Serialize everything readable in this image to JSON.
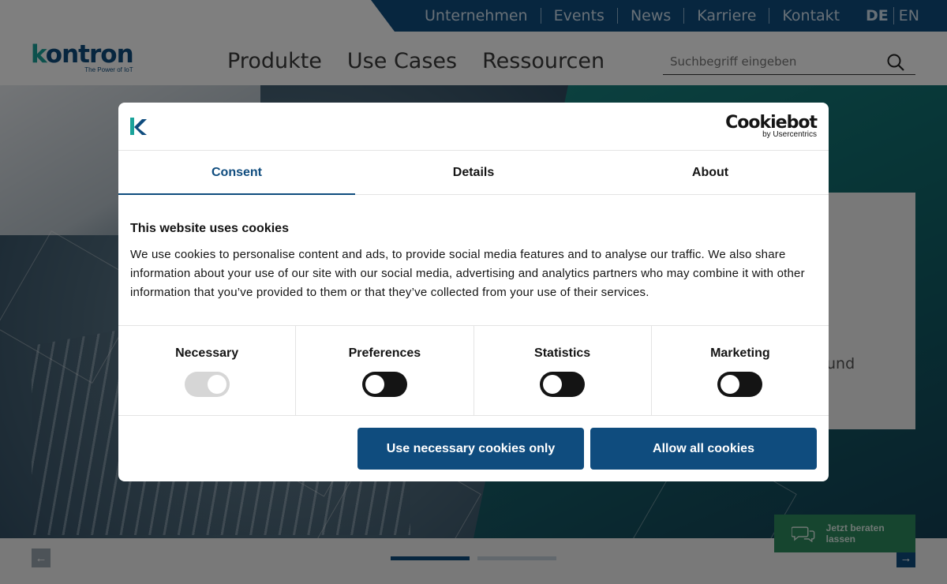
{
  "utility_nav": [
    "Unternehmen",
    "Events",
    "News",
    "Karriere",
    "Kontakt"
  ],
  "languages": {
    "de": "DE",
    "en": "EN"
  },
  "brand": {
    "name_k": "k",
    "name_rest": "ontron",
    "tagline": "The Power of IoT"
  },
  "main_nav": [
    "Produkte",
    "Use Cases",
    "Ressourcen"
  ],
  "search": {
    "placeholder": "Suchbegriff eingeben"
  },
  "hero": {
    "card_fragment": "und"
  },
  "chat": {
    "label": "Jetzt beraten lassen"
  },
  "cookie_dialog": {
    "provider": {
      "name": "Cookiebot",
      "byline": "by Usercentrics"
    },
    "tabs": [
      {
        "label": "Consent",
        "active": true
      },
      {
        "label": "Details",
        "active": false
      },
      {
        "label": "About",
        "active": false
      }
    ],
    "heading": "This website uses cookies",
    "text": "We use cookies to personalise content and ads, to provide social media features and to analyse our traffic. We also share information about your use of our site with our social media, advertising and analytics partners who may combine it with other information that you’ve provided to them or that they’ve collected from your use of their services.",
    "categories": [
      {
        "label": "Necessary",
        "state": "on-disabled"
      },
      {
        "label": "Preferences",
        "state": "off"
      },
      {
        "label": "Statistics",
        "state": "off"
      },
      {
        "label": "Marketing",
        "state": "off"
      }
    ],
    "buttons": {
      "necessary": "Use necessary cookies only",
      "allow_all": "Allow all cookies"
    }
  },
  "colors": {
    "brand_blue": "#0f4c7e",
    "brand_teal": "#1aa39a",
    "chat_green": "#2d8a5f"
  }
}
